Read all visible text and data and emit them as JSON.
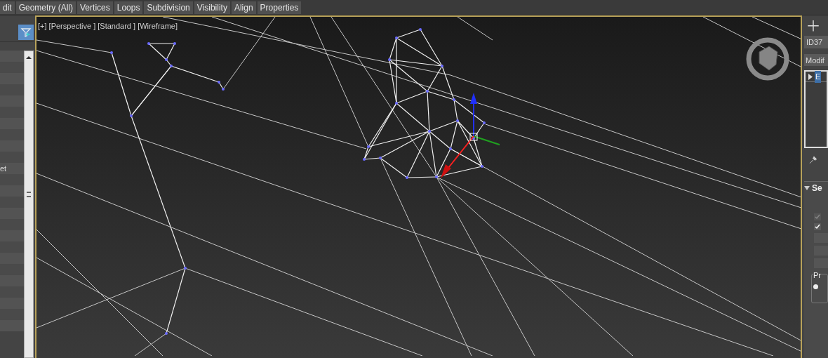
{
  "ribbon": {
    "tabs": [
      "dit",
      "Geometry (All)",
      "Vertices",
      "Loops",
      "Subdivision",
      "Visibility",
      "Align",
      "Properties"
    ]
  },
  "left_panel": {
    "row_text": "et"
  },
  "viewport": {
    "label": "[+] [Perspective ] [Standard ] [Wireframe]"
  },
  "command_panel": {
    "object_name": "ID37",
    "modifier_list": "Modif",
    "stack_items": [
      {
        "label": "E",
        "selected": true
      }
    ],
    "rollout": {
      "title": "Se",
      "expanded": true
    },
    "checkboxes": [
      {
        "checked": true,
        "disabled": true
      },
      {
        "checked": true,
        "disabled": false
      }
    ],
    "group": {
      "title": "Pr",
      "radio": {
        "selected": true
      }
    }
  }
}
